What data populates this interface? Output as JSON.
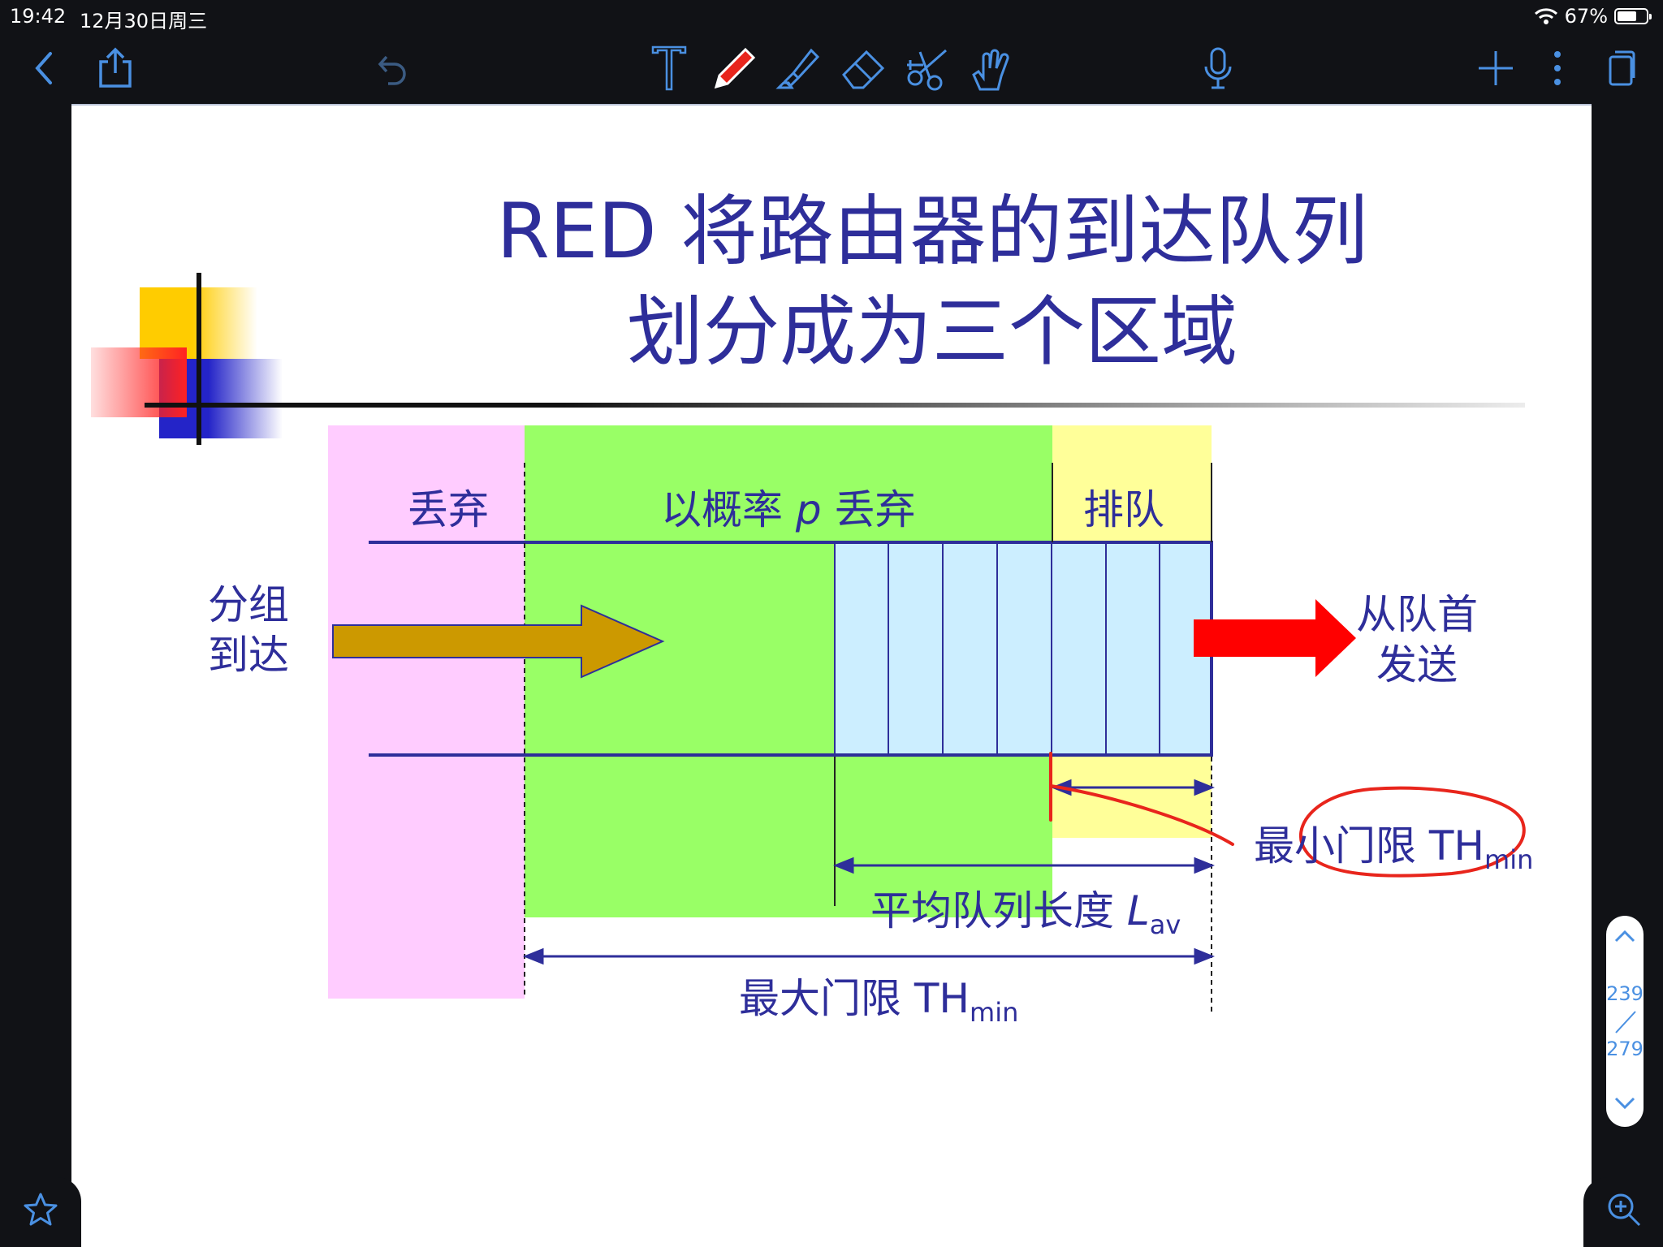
{
  "status_bar": {
    "time": "19:42",
    "date": "12月30日周三",
    "battery": "67%",
    "battery_level": 0.67
  },
  "toolbar": {
    "icons": [
      "back-chevron-icon",
      "share-icon",
      "undo-icon",
      "text-tool-icon",
      "pen-tool-icon",
      "highlighter-icon",
      "eraser-icon",
      "scissors-icon",
      "hand-tool-icon",
      "microphone-icon",
      "add-icon",
      "more-icon",
      "pages-icon"
    ],
    "active_tool": "pen-tool-icon",
    "accent": "#4a90e2"
  },
  "slide": {
    "title_line1": "RED 将路由器的到达队列",
    "title_line2": "划分成为三个区域",
    "zone_drop": "丢弃",
    "zone_prob_prefix": "以概率",
    "zone_prob_var": "p",
    "zone_prob_suffix": "丢弃",
    "zone_queue": "排队",
    "arrival_1": "分组",
    "arrival_2": "到达",
    "depart_1": "从队首",
    "depart_2": "发送",
    "min_label": "最小门限 TH",
    "min_sub": "min",
    "avg_label": "平均队列长度",
    "avg_var": "L",
    "avg_sub": "av",
    "max_label": "最大门限 TH",
    "max_sub": "min",
    "colors": {
      "text": "#2e2e9a",
      "drop_zone": "#ffccff",
      "prob_zone": "#99ff66",
      "queue_zone": "#ffff99",
      "buffer": "#cceeff",
      "arrival_arrow": "#cc9900",
      "depart_arrow": "#ff0000",
      "annotation": "#e8251c"
    }
  },
  "page_indicator": {
    "current": "239",
    "total": "279"
  }
}
